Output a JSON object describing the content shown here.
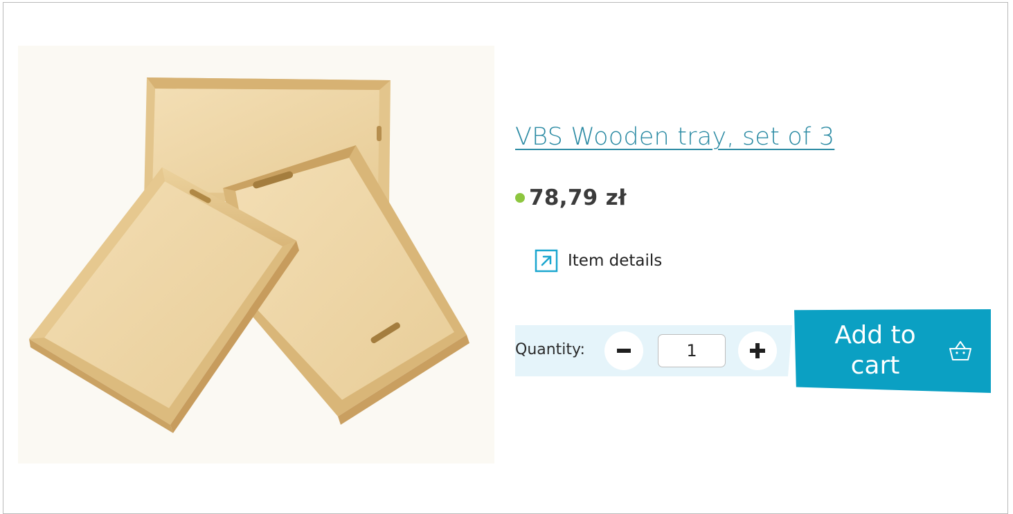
{
  "product": {
    "title": "VBS Wooden tray, set of 3",
    "price": "78,79 zł",
    "availability_color": "#8dc63f",
    "image_icon": "product-photo-wooden-trays"
  },
  "details_link": {
    "label": "Item details",
    "icon": "external-link-icon"
  },
  "quantity": {
    "label": "Quantity:",
    "value": "1",
    "minus_icon": "minus-icon",
    "plus_icon": "plus-icon"
  },
  "cart": {
    "label": "Add to\ncart",
    "icon": "basket-icon",
    "button_color": "#0ba0c3"
  },
  "colors": {
    "title": "#2a8aa3",
    "accent": "#0ba0c3",
    "quantity_band": "#e5f4fa"
  }
}
